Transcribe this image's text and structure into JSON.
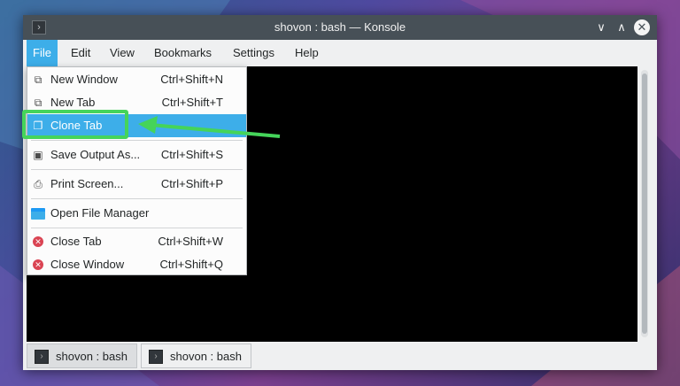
{
  "window": {
    "title": "shovon : bash — Konsole",
    "controls": {
      "minimize": "∨",
      "maximize": "∧",
      "close": "✕"
    }
  },
  "menubar": {
    "items": [
      "File",
      "Edit",
      "View",
      "Bookmarks",
      "Settings",
      "Help"
    ],
    "active": "File"
  },
  "file_menu": {
    "items": [
      {
        "label": "New Window",
        "shortcut": "Ctrl+Shift+N",
        "icon": "new-window-icon"
      },
      {
        "label": "New Tab",
        "shortcut": "Ctrl+Shift+T",
        "icon": "new-tab-icon"
      },
      {
        "label": "Clone Tab",
        "shortcut": "",
        "icon": "clone-tab-icon",
        "highlighted": true
      },
      {
        "label": "Save Output As...",
        "shortcut": "Ctrl+Shift+S",
        "icon": "save-output-icon"
      },
      {
        "label": "Print Screen...",
        "shortcut": "Ctrl+Shift+P",
        "icon": "print-icon"
      },
      {
        "label": "Open File Manager",
        "shortcut": "",
        "icon": "folder-icon"
      },
      {
        "label": "Close Tab",
        "shortcut": "Ctrl+Shift+W",
        "icon": "close-circle-icon"
      },
      {
        "label": "Close Window",
        "shortcut": "Ctrl+Shift+Q",
        "icon": "close-circle-icon"
      }
    ]
  },
  "tabs": [
    {
      "label": "shovon : bash",
      "current": true
    },
    {
      "label": "shovon : bash",
      "current": false
    }
  ],
  "annotation": {
    "color": "#45d45a"
  },
  "colors": {
    "accent": "#3daee9",
    "titlebar": "#475057",
    "terminal_bg": "#000000",
    "close_icon_red": "#da4453"
  }
}
